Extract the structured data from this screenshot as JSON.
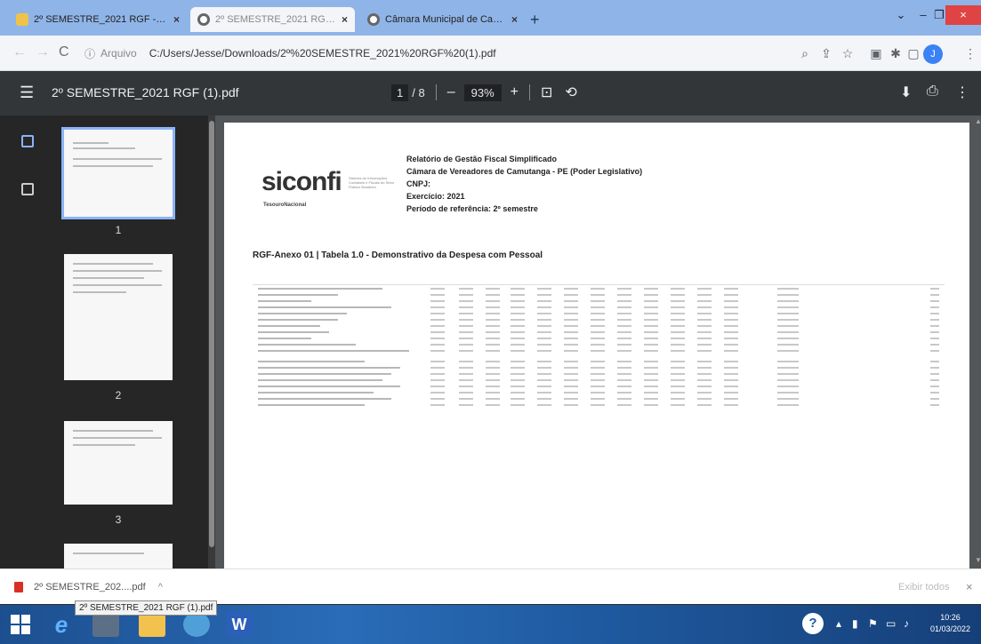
{
  "browser": {
    "tabs": [
      {
        "title": "2º SEMESTRE_2021 RGF - Câmara",
        "close": "×"
      },
      {
        "title": "2º SEMESTRE_2021 RGF (1).pdf",
        "close": "×"
      },
      {
        "title": "Câmara Municipal de Camutanga",
        "close": "×"
      }
    ],
    "new_tab": "+",
    "window_controls": {
      "menu": "⌄",
      "minimize": "–",
      "maximize": "❐",
      "close": "×"
    },
    "nav": {
      "back": "←",
      "forward": "→",
      "reload": "C"
    },
    "address": {
      "info_icon": "ⓘ",
      "label": "Arquivo",
      "url": "C:/Users/Jesse/Downloads/2º%20SEMESTRE_2021%20RGF%20(1).pdf"
    },
    "toolbar_icons": [
      "search-icon",
      "share-icon",
      "star-icon",
      "extension-icon",
      "puzzle-icon",
      "sidebar-icon"
    ],
    "profile_initial": "J",
    "more": "⋮"
  },
  "pdf": {
    "menu": "☰",
    "title": "2º SEMESTRE_2021 RGF (1).pdf",
    "page_current": "1",
    "page_total": "/ 8",
    "zoom_out": "–",
    "zoom": "93%",
    "zoom_in": "+",
    "download": "⬇",
    "print": "⎙",
    "more": "⋮"
  },
  "thumbnails": [
    {
      "number": "1",
      "selected": true
    },
    {
      "number": "2",
      "selected": false
    },
    {
      "number": "3",
      "selected": false
    }
  ],
  "document": {
    "logo": "siconfi",
    "logo_sub": "Sistema de Informações Contábeis e Fiscais do Setor Público Brasileiro",
    "logo_brand": "TesouroNacional",
    "header": [
      "Relatório de Gestão Fiscal Simplificado",
      "Câmara de Vereadores de Camutanga - PE (Poder Legislativo)",
      "CNPJ:",
      "Exercício: 2021",
      "Período de referência: 2º semestre"
    ],
    "table_title": "RGF-Anexo 01 | Tabela 1.0 - Demonstrativo da Despesa com Pessoal"
  },
  "downloads": {
    "file": "2º SEMESTRE_202....pdf",
    "chevron": "^",
    "show_all": "Exibir todos",
    "close": "×",
    "tooltip": "2º SEMESTRE_2021 RGF (1).pdf"
  },
  "taskbar": {
    "apps": [
      "e",
      "W"
    ],
    "help": "?",
    "time": "10:26",
    "date": "01/03/2022"
  }
}
